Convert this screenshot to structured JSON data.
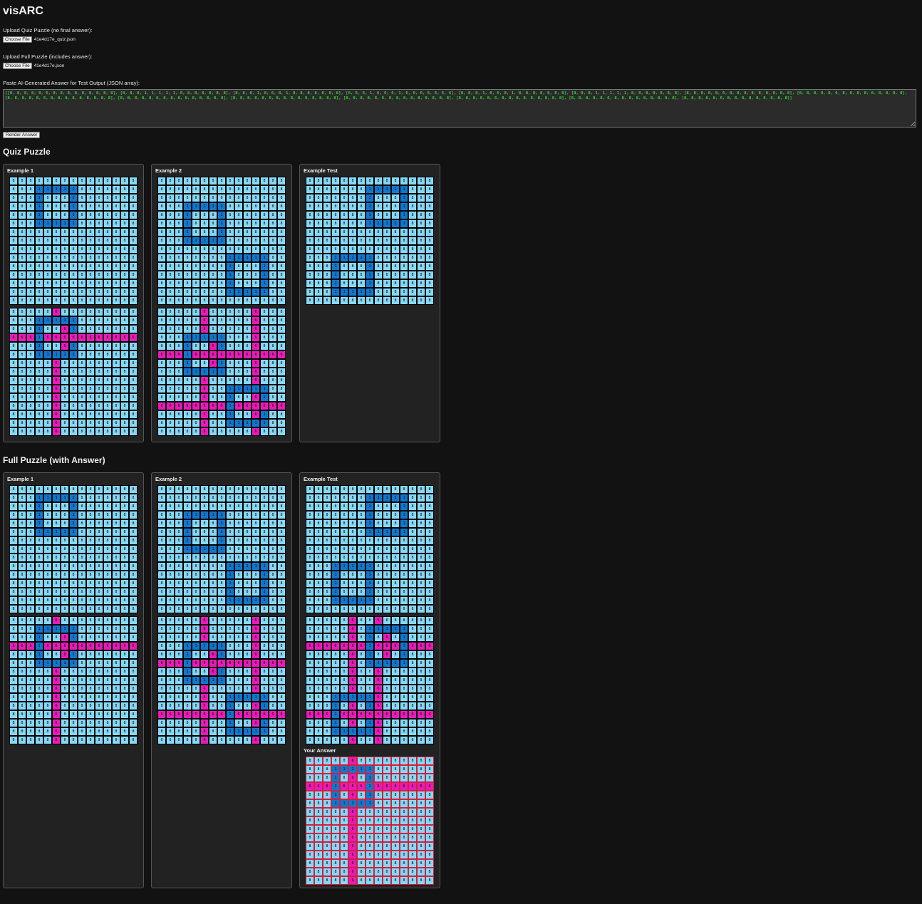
{
  "app": {
    "title": "visARC"
  },
  "uploads": {
    "quiz_label": "Upload Quiz Puzzle (no final answer):",
    "quiz_button": "Choose File",
    "quiz_file": "41e4d17e_quiz.json",
    "full_label": "Upload Full Puzzle (includes answer):",
    "full_button": "Choose File",
    "full_file": "41e4d17e.json"
  },
  "answer_input": {
    "label": "Paste AI-Generated Answer for Test Output (JSON array):",
    "value": "[[8, 8, 8, 8, 8, 6, 8, 8, 8, 8, 8, 8, 8, 8, 8], [8, 8, 8, 1, 1, 1, 1, 1, 8, 8, 8, 8, 8, 8, 8], [8, 8, 8, 1, 8, 6, 8, 1, 8, 8, 8, 8, 8, 8, 8], [6, 6, 6, 1, 6, 6, 6, 1, 6, 6, 6, 6, 6, 6, 6], [8, 8, 8, 1, 8, 6, 8, 1, 8, 8, 8, 8, 8, 8, 8], [8, 8, 8, 1, 1, 1, 1, 1, 8, 8, 8, 8, 8, 8, 8], [8, 8, 8, 8, 8, 6, 8, 8, 8, 8, 8, 8, 8, 8, 8], [8, 8, 8, 8, 8, 6, 8, 8, 8, 8, 8, 8, 8, 8, 8], [8, 8, 8, 8, 8, 6, 8, 8, 8, 8, 8, 8, 8, 8, 8], [8, 8, 8, 8, 8, 6, 8, 8, 8, 8, 8, 8, 8, 8, 8], [8, 8, 8, 8, 8, 6, 8, 8, 8, 8, 8, 8, 8, 8, 8], [8, 8, 8, 8, 8, 6, 8, 8, 8, 8, 8, 8, 8, 8, 8], [8, 8, 8, 8, 8, 6, 8, 8, 8, 8, 8, 8, 8, 8, 8], [8, 8, 8, 8, 8, 6, 8, 8, 8, 8, 8, 8, 8, 8, 8], [8, 8, 8, 8, 8, 6, 8, 8, 8, 8, 8, 8, 8, 8, 8]]",
    "render_button": "Render Answer"
  },
  "colors": {
    "8": "#87d8f5",
    "1": "#1177cc",
    "6": "#ea1ab8"
  },
  "quiz": {
    "heading": "Quiz Puzzle",
    "cards": [
      {
        "title": "Example 1",
        "grids": [
          [
            "888888888888888",
            "888111118888888",
            "888188818888888",
            "888188818888888",
            "888188818888888",
            "888111118888888",
            "888888888888888",
            "888888888888888",
            "888888888888888",
            "888888888888888",
            "888888888888888",
            "888888888888888",
            "888888888888888",
            "888888888888888",
            "888888888888888"
          ],
          [
            "888886888888888",
            "888111118888888",
            "888188618888888",
            "666166666666666",
            "888188618888888",
            "888111118888888",
            "888886888888888",
            "888886888888888",
            "888886888888888",
            "888886888888888",
            "888886888888888",
            "888886888888888",
            "888886888888888",
            "888886888888888",
            "888886888888888"
          ]
        ]
      },
      {
        "title": "Example 2",
        "grids": [
          [
            "888888888888888",
            "888888888888888",
            "888888888888888",
            "888111118888888",
            "888188818888888",
            "888188818888888",
            "888188818888888",
            "888111118888888",
            "888888888888888",
            "888888881111188",
            "888888881888188",
            "888888881888188",
            "888888881888188",
            "888888881111188",
            "888888888888888"
          ],
          [
            "888886888886888",
            "888886888886888",
            "888886888886888",
            "888111118886888",
            "888188618886888",
            "666166666666666",
            "888188618886888",
            "888111118886888",
            "888886888886888",
            "888886881111188",
            "888886881886188",
            "666666661666666",
            "888886881886188",
            "888886881111188",
            "888886888886888"
          ]
        ]
      },
      {
        "title": "Example Test",
        "grids": [
          [
            "888888888888888",
            "888888811111888",
            "888888818881888",
            "888888818881888",
            "888888818881888",
            "888888811111888",
            "888888888888888",
            "888888888888888",
            "888888888888888",
            "888111118888888",
            "888188818888888",
            "888188818888888",
            "888188818888888",
            "888111118888888",
            "888888888888888"
          ]
        ]
      }
    ]
  },
  "full": {
    "heading": "Full Puzzle (with Answer)",
    "answer_label": "Your Answer",
    "cards": [
      {
        "title": "Example 1",
        "grids": [
          [
            "888888888888888",
            "888111118888888",
            "888188818888888",
            "888188818888888",
            "888188818888888",
            "888111118888888",
            "888888888888888",
            "888888888888888",
            "888888888888888",
            "888888888888888",
            "888888888888888",
            "888888888888888",
            "888888888888888",
            "888888888888888",
            "888888888888888"
          ],
          [
            "888886888888888",
            "888111118888888",
            "888188618888888",
            "666166666666666",
            "888188618888888",
            "888111118888888",
            "888886888888888",
            "888886888888888",
            "888886888888888",
            "888886888888888",
            "888886888888888",
            "888886888888888",
            "888886888888888",
            "888886888888888",
            "888886888888888"
          ]
        ]
      },
      {
        "title": "Example 2",
        "grids": [
          [
            "888888888888888",
            "888888888888888",
            "888888888888888",
            "888111118888888",
            "888188818888888",
            "888188818888888",
            "888188818888888",
            "888111118888888",
            "888888888888888",
            "888888881111188",
            "888888881888188",
            "888888881888188",
            "888888881888188",
            "888888881111188",
            "888888888888888"
          ],
          [
            "888886888886888",
            "888886888886888",
            "888886888886888",
            "888111118886888",
            "888188618886888",
            "666166666666666",
            "888188618886888",
            "888111118886888",
            "888886888886888",
            "888886881111188",
            "888886881886188",
            "666666661666666",
            "888886881886188",
            "888886881111188",
            "888886888886888"
          ]
        ]
      },
      {
        "title": "Example Test",
        "grids": [
          [
            "888888888888888",
            "888888811111888",
            "888888818881888",
            "888888818881888",
            "888888818881888",
            "888888811111888",
            "888888888888888",
            "888888888888888",
            "888888888888888",
            "888111118888888",
            "888188818888888",
            "888188818888888",
            "888188818888888",
            "888111118888888",
            "888888888888888"
          ],
          [
            "888886886888888",
            "888886811111888",
            "888886818681888",
            "666666616661666",
            "888886818681888",
            "888886811111888",
            "888886886888888",
            "888886886888888",
            "888886886888888",
            "888111116888888",
            "888186816888888",
            "666166666666666",
            "888186816888888",
            "888111116888888",
            "888886886888888"
          ]
        ],
        "answer": [
          "888886888888888",
          "888111118888888",
          "888186818888888",
          "666166616666666",
          "888186818888888",
          "888111118888888",
          "888886888888888",
          "888886888888888",
          "888886888888888",
          "888886888888888",
          "888886888888888",
          "888886888888888",
          "888886888888888",
          "888886888888888",
          "888886888888888"
        ]
      }
    ]
  }
}
